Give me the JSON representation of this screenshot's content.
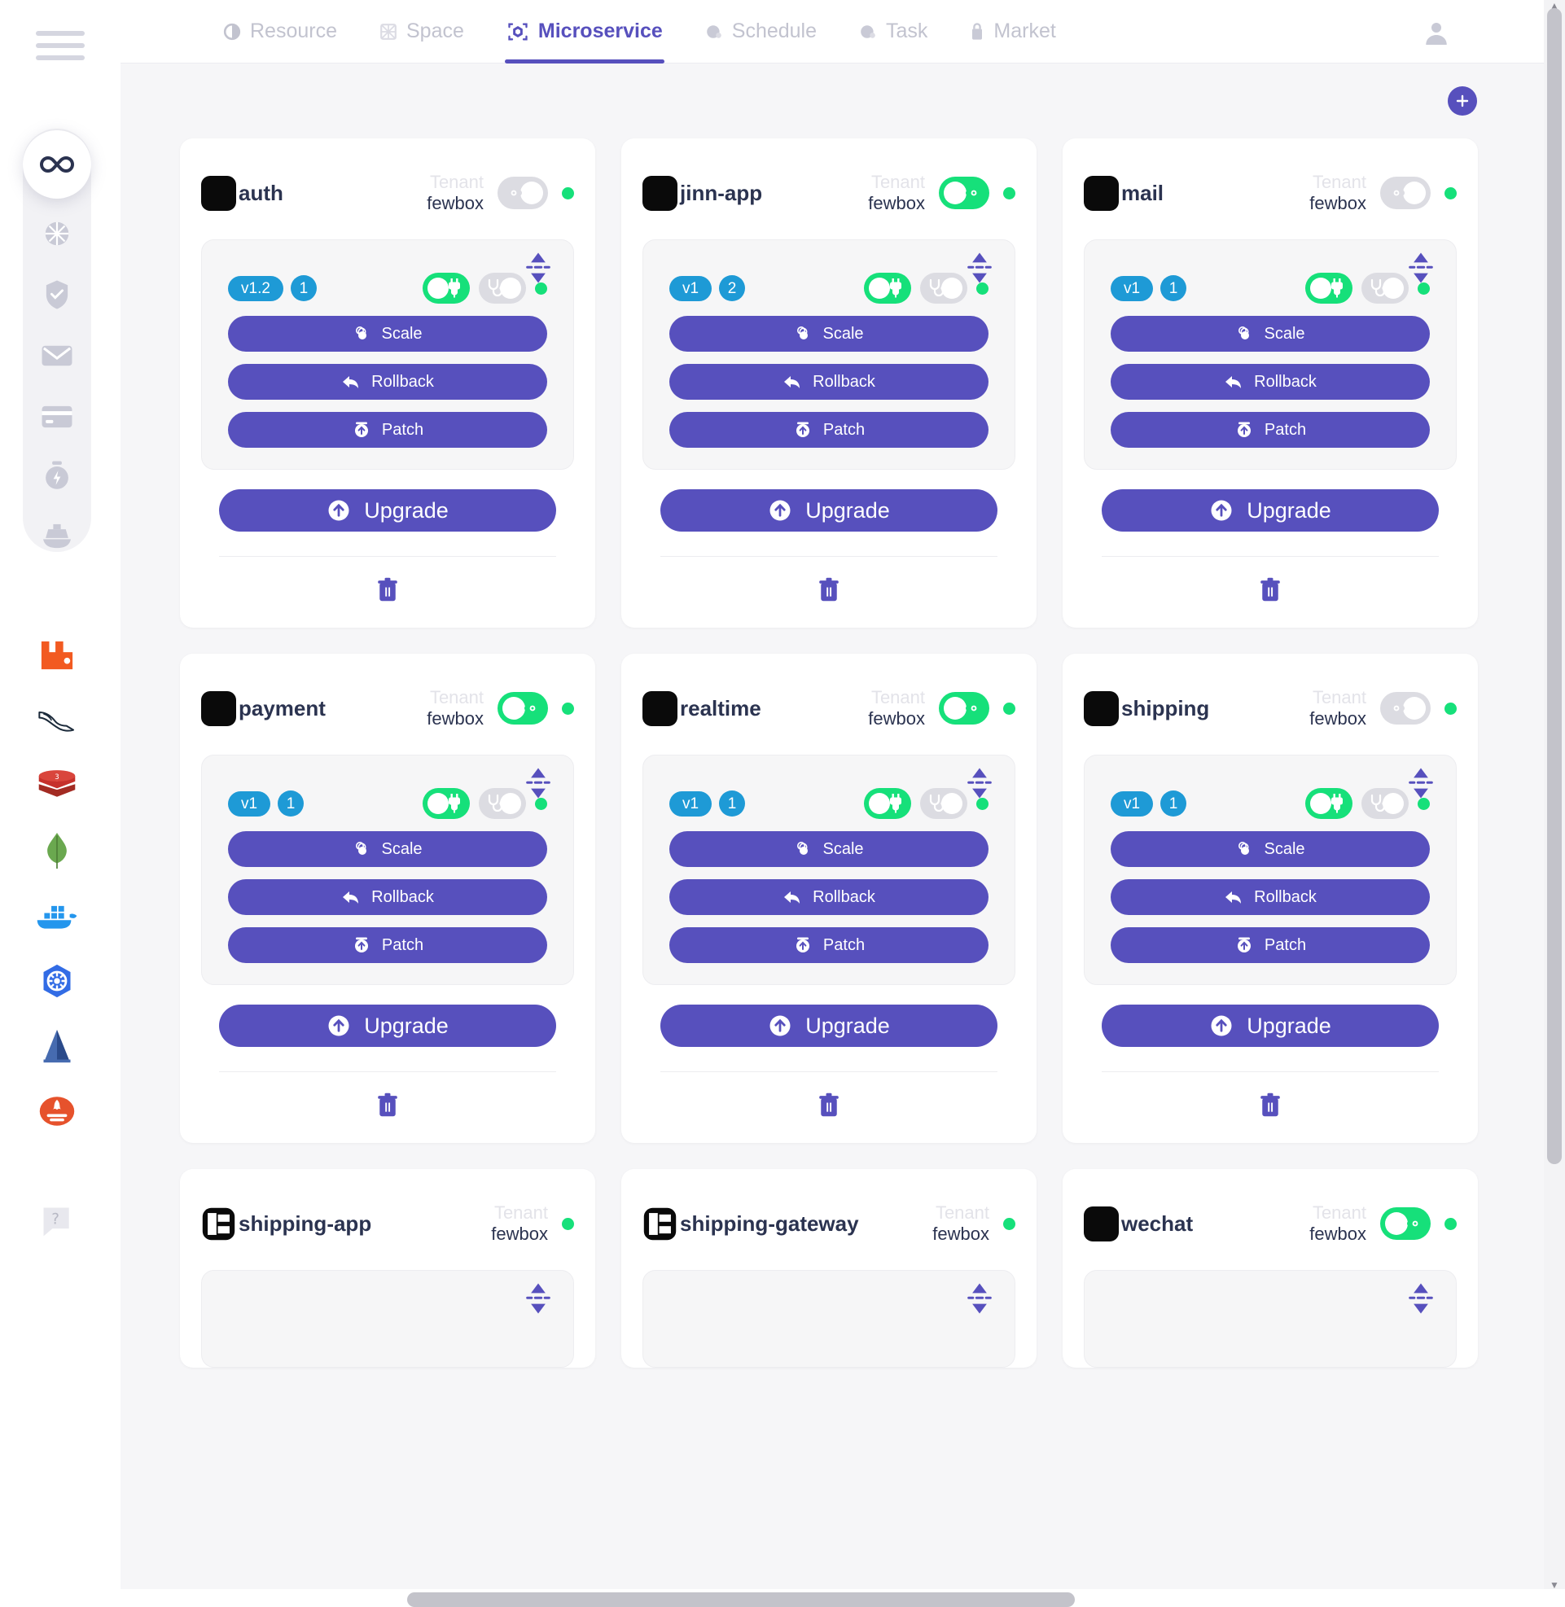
{
  "app": {
    "accent": "#5750bd",
    "status_green": "#16e07a",
    "badge_blue": "#1e9ad6",
    "tenant_label": "Tenant"
  },
  "nav": {
    "tabs": [
      {
        "label": "Resource",
        "icon": "resource-icon",
        "active": false
      },
      {
        "label": "Space",
        "icon": "space-icon",
        "active": false
      },
      {
        "label": "Microservice",
        "icon": "microservice-icon",
        "active": true
      },
      {
        "label": "Schedule",
        "icon": "schedule-icon",
        "active": false
      },
      {
        "label": "Task",
        "icon": "task-icon",
        "active": false
      },
      {
        "label": "Market",
        "icon": "market-icon",
        "active": false
      }
    ],
    "avatar_icon": "user-avatar-icon"
  },
  "sidebar": {
    "menu_icon": "hamburger-menu-icon",
    "primary": [
      {
        "icon": "infinity-icon",
        "active": true
      },
      {
        "icon": "globe-grid-icon",
        "active": false
      },
      {
        "icon": "shield-check-icon",
        "active": false
      },
      {
        "icon": "envelope-icon",
        "active": false
      },
      {
        "icon": "credit-card-icon",
        "active": false
      },
      {
        "icon": "stopwatch-bolt-icon",
        "active": false
      },
      {
        "icon": "ship-icon",
        "active": false
      }
    ],
    "tech": [
      {
        "icon": "rabbitmq-icon"
      },
      {
        "icon": "mysql-dolphin-icon"
      },
      {
        "icon": "redis-icon"
      },
      {
        "icon": "mongodb-leaf-icon"
      },
      {
        "icon": "docker-whale-icon"
      },
      {
        "icon": "kubernetes-helm-icon"
      },
      {
        "icon": "istio-sail-icon"
      },
      {
        "icon": "prometheus-torch-icon"
      }
    ],
    "help": {
      "icon": "help-chat-icon"
    }
  },
  "toolbar": {
    "add_label": "+",
    "add_icon": "plus-icon"
  },
  "actions": {
    "scale_label": "Scale",
    "rollback_label": "Rollback",
    "patch_label": "Patch",
    "upgrade_label": "Upgrade",
    "delete_icon": "trash-icon",
    "scale_icon": "scale-icon",
    "rollback_icon": "rollback-arrow-icon",
    "patch_icon": "patch-up-icon",
    "upgrade_icon": "upgrade-up-icon",
    "sort_icon": "sort-updown-icon"
  },
  "cards": [
    {
      "name": "auth",
      "icon": "app-square-icon",
      "tenant": "fewbox",
      "visibility_on": false,
      "status_ok": true,
      "has_toggle": true,
      "version": "v1.2",
      "count": "1",
      "plug_on": true,
      "health_on": false,
      "pod_ok": true,
      "has_body": true
    },
    {
      "name": "jinn-app",
      "icon": "app-square-icon",
      "tenant": "fewbox",
      "visibility_on": true,
      "status_ok": true,
      "has_toggle": true,
      "version": "v1",
      "count": "2",
      "plug_on": true,
      "health_on": false,
      "pod_ok": true,
      "has_body": true
    },
    {
      "name": "mail",
      "icon": "app-square-icon",
      "tenant": "fewbox",
      "visibility_on": false,
      "status_ok": true,
      "has_toggle": true,
      "version": "v1",
      "count": "1",
      "plug_on": true,
      "health_on": false,
      "pod_ok": true,
      "has_body": true
    },
    {
      "name": "payment",
      "icon": "app-square-icon",
      "tenant": "fewbox",
      "visibility_on": true,
      "status_ok": true,
      "has_toggle": true,
      "version": "v1",
      "count": "1",
      "plug_on": true,
      "health_on": false,
      "pod_ok": true,
      "has_body": true
    },
    {
      "name": "realtime",
      "icon": "app-square-icon",
      "tenant": "fewbox",
      "visibility_on": true,
      "status_ok": true,
      "has_toggle": true,
      "version": "v1",
      "count": "1",
      "plug_on": true,
      "health_on": false,
      "pod_ok": true,
      "has_body": true
    },
    {
      "name": "shipping",
      "icon": "app-square-icon",
      "tenant": "fewbox",
      "visibility_on": false,
      "status_ok": true,
      "has_toggle": true,
      "version": "v1",
      "count": "1",
      "plug_on": true,
      "health_on": false,
      "pod_ok": true,
      "has_body": true
    },
    {
      "name": "shipping-app",
      "icon": "diagram-square-icon",
      "tenant": "fewbox",
      "visibility_on": null,
      "status_ok": true,
      "has_toggle": false,
      "version": "",
      "count": "",
      "plug_on": null,
      "health_on": null,
      "pod_ok": null,
      "has_body": false
    },
    {
      "name": "shipping-gateway",
      "icon": "diagram-square-icon",
      "tenant": "fewbox",
      "visibility_on": null,
      "status_ok": true,
      "has_toggle": false,
      "version": "",
      "count": "",
      "plug_on": null,
      "health_on": null,
      "pod_ok": null,
      "has_body": false
    },
    {
      "name": "wechat",
      "icon": "app-square-icon",
      "tenant": "fewbox",
      "visibility_on": true,
      "status_ok": true,
      "has_toggle": true,
      "version": "",
      "count": "",
      "plug_on": null,
      "health_on": null,
      "pod_ok": null,
      "has_body": false
    }
  ]
}
